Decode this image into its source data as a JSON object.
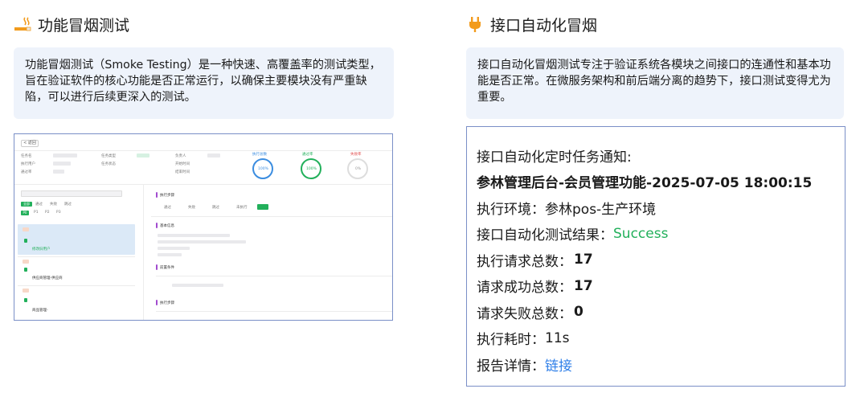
{
  "left": {
    "title": "功能冒烟测试",
    "icon": "cigarette-icon",
    "description": "功能冒烟测试（Smoke Testing）是一种快速、高覆盖率的测试类型，旨在验证软件的核心功能是否正常运行，以确保主要模块没有严重缺陷，可以进行后续更深入的测试。",
    "screenshot": {
      "back": "< 返回",
      "fields": [
        "任务名",
        "执行用户",
        "通过率",
        "任务类型",
        "任务状态",
        "负责人",
        "开始时间",
        "结束时间"
      ],
      "stat_labels": [
        "执行总数",
        "通过率",
        "失败率"
      ],
      "stat_values": [
        "100%",
        "100%",
        "0%"
      ],
      "filter_tabs": [
        "全部",
        "通过",
        "失败",
        "跳过"
      ],
      "priority_tabs": [
        "P0",
        "P1",
        "P2",
        "P3"
      ],
      "panel_titles": [
        "执行步骤",
        "基本信息",
        "前置条件",
        "执行步骤"
      ],
      "status_options": [
        "通过",
        "失败",
        "跳过",
        "未执行"
      ],
      "case_names": [
        "修改旧用户",
        "供应商管理-供应商",
        "商品管理-"
      ]
    }
  },
  "right": {
    "title": "接口自动化冒烟",
    "icon": "plug-icon",
    "description": "接口自动化冒烟测试专注于验证系统各模块之间接口的连通性和基本功能是否正常。在微服务架构和前后端分离的趋势下，接口测试变得尤为重要。",
    "notice": {
      "header": "接口自动化定时任务通知:",
      "task": "参林管理后台-会员管理功能-2025-07-05 18:00:15",
      "env_label": "执行环境：",
      "env_value": "参林pos-生产环境",
      "result_label": "接口自动化测试结果：",
      "result_value": "Success",
      "total_label": "执行请求总数：",
      "total_value": "17",
      "success_label": "请求成功总数：",
      "success_value": "17",
      "fail_label": "请求失败总数：",
      "fail_value": "0",
      "time_label": "执行耗时：",
      "time_value": "11s",
      "report_label": "报告详情：",
      "report_link": "链接"
    }
  },
  "colors": {
    "card_bg": "#eef3fb",
    "border": "#7a8fc7",
    "success": "#22b05b",
    "link": "#2f7fe8",
    "icon_orange": "#f29b1d"
  }
}
